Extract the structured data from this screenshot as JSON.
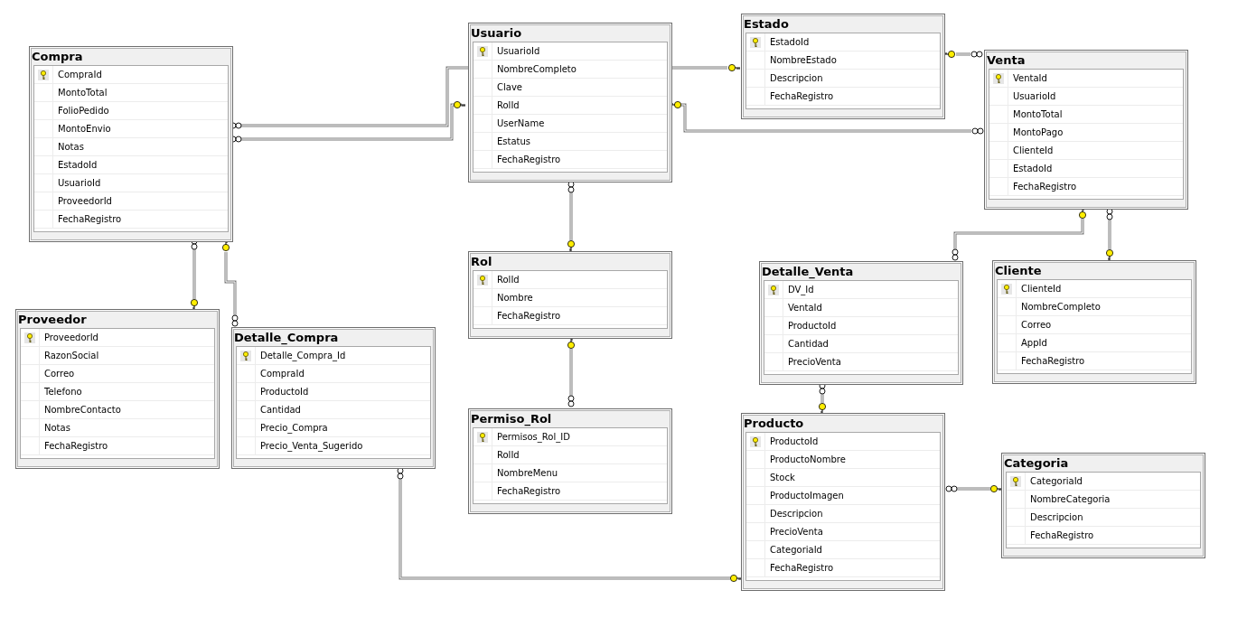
{
  "tables": [
    {
      "name": "Compra",
      "columns": [
        {
          "name": "CompraId",
          "primary_key": true
        },
        {
          "name": "MontoTotal",
          "primary_key": false
        },
        {
          "name": "FolioPedido",
          "primary_key": false
        },
        {
          "name": "MontoEnvio",
          "primary_key": false
        },
        {
          "name": "Notas",
          "primary_key": false
        },
        {
          "name": "EstadoId",
          "primary_key": false
        },
        {
          "name": "UsuarioId",
          "primary_key": false
        },
        {
          "name": "ProveedorId",
          "primary_key": false
        },
        {
          "name": "FechaRegistro",
          "primary_key": false
        }
      ]
    },
    {
      "name": "Usuario",
      "columns": [
        {
          "name": "UsuarioId",
          "primary_key": true
        },
        {
          "name": "NombreCompleto",
          "primary_key": false
        },
        {
          "name": "Clave",
          "primary_key": false
        },
        {
          "name": "RolId",
          "primary_key": false
        },
        {
          "name": "UserName",
          "primary_key": false
        },
        {
          "name": "Estatus",
          "primary_key": false
        },
        {
          "name": "FechaRegistro",
          "primary_key": false
        }
      ]
    },
    {
      "name": "Estado",
      "columns": [
        {
          "name": "EstadoId",
          "primary_key": true
        },
        {
          "name": "NombreEstado",
          "primary_key": false
        },
        {
          "name": "Descripcion",
          "primary_key": false
        },
        {
          "name": "FechaRegistro",
          "primary_key": false
        }
      ]
    },
    {
      "name": "Venta",
      "columns": [
        {
          "name": "VentaId",
          "primary_key": true
        },
        {
          "name": "UsuarioId",
          "primary_key": false
        },
        {
          "name": "MontoTotal",
          "primary_key": false
        },
        {
          "name": "MontoPago",
          "primary_key": false
        },
        {
          "name": "ClienteId",
          "primary_key": false
        },
        {
          "name": "EstadoId",
          "primary_key": false
        },
        {
          "name": "FechaRegistro",
          "primary_key": false
        }
      ]
    },
    {
      "name": "Rol",
      "columns": [
        {
          "name": "RolId",
          "primary_key": true
        },
        {
          "name": "Nombre",
          "primary_key": false
        },
        {
          "name": "FechaRegistro",
          "primary_key": false
        }
      ]
    },
    {
      "name": "Proveedor",
      "columns": [
        {
          "name": "ProveedorId",
          "primary_key": true
        },
        {
          "name": "RazonSocial",
          "primary_key": false
        },
        {
          "name": "Correo",
          "primary_key": false
        },
        {
          "name": "Telefono",
          "primary_key": false
        },
        {
          "name": "NombreContacto",
          "primary_key": false
        },
        {
          "name": "Notas",
          "primary_key": false
        },
        {
          "name": "FechaRegistro",
          "primary_key": false
        }
      ]
    },
    {
      "name": "Detalle_Compra",
      "columns": [
        {
          "name": "Detalle_Compra_Id",
          "primary_key": true
        },
        {
          "name": "CompraId",
          "primary_key": false
        },
        {
          "name": "ProductoId",
          "primary_key": false
        },
        {
          "name": "Cantidad",
          "primary_key": false
        },
        {
          "name": "Precio_Compra",
          "primary_key": false
        },
        {
          "name": "Precio_Venta_Sugerido",
          "primary_key": false
        }
      ]
    },
    {
      "name": "Detalle_Venta",
      "columns": [
        {
          "name": "DV_Id",
          "primary_key": true
        },
        {
          "name": "VentaId",
          "primary_key": false
        },
        {
          "name": "ProductoId",
          "primary_key": false
        },
        {
          "name": "Cantidad",
          "primary_key": false
        },
        {
          "name": "PrecioVenta",
          "primary_key": false
        }
      ]
    },
    {
      "name": "Cliente",
      "columns": [
        {
          "name": "ClienteId",
          "primary_key": true
        },
        {
          "name": "NombreCompleto",
          "primary_key": false
        },
        {
          "name": "Correo",
          "primary_key": false
        },
        {
          "name": "AppId",
          "primary_key": false
        },
        {
          "name": "FechaRegistro",
          "primary_key": false
        }
      ]
    },
    {
      "name": "Permiso_Rol",
      "columns": [
        {
          "name": "Permisos_Rol_ID",
          "primary_key": true
        },
        {
          "name": "RolId",
          "primary_key": false
        },
        {
          "name": "NombreMenu",
          "primary_key": false
        },
        {
          "name": "FechaRegistro",
          "primary_key": false
        }
      ]
    },
    {
      "name": "Producto",
      "columns": [
        {
          "name": "ProductoId",
          "primary_key": true
        },
        {
          "name": "ProductoNombre",
          "primary_key": false
        },
        {
          "name": "Stock",
          "primary_key": false
        },
        {
          "name": "ProductoImagen",
          "primary_key": false
        },
        {
          "name": "Descripcion",
          "primary_key": false
        },
        {
          "name": "PrecioVenta",
          "primary_key": false
        },
        {
          "name": "CategoriaId",
          "primary_key": false
        },
        {
          "name": "FechaRegistro",
          "primary_key": false
        }
      ]
    },
    {
      "name": "Categoria",
      "columns": [
        {
          "name": "CategoriaId",
          "primary_key": true
        },
        {
          "name": "NombreCategoria",
          "primary_key": false
        },
        {
          "name": "Descripcion",
          "primary_key": false
        },
        {
          "name": "FechaRegistro",
          "primary_key": false
        }
      ]
    }
  ]
}
